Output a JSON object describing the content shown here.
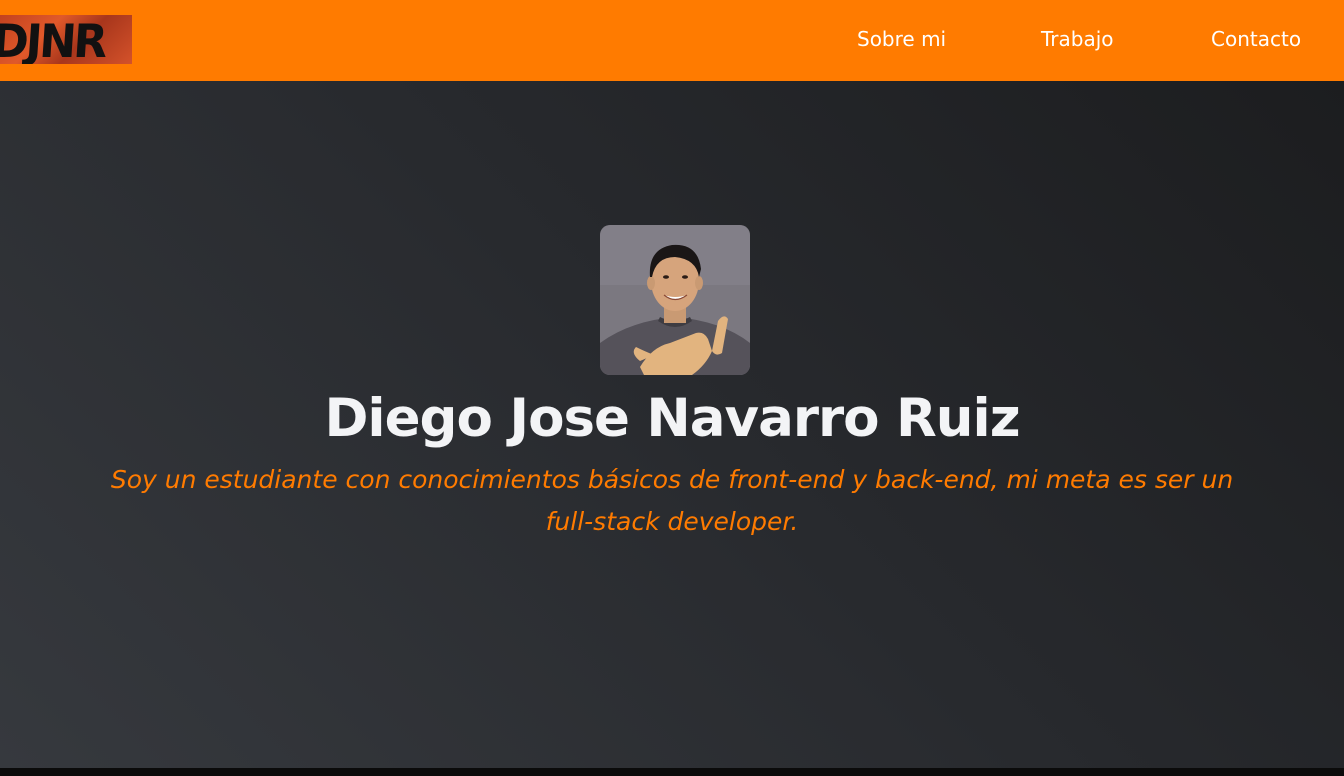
{
  "brand": {
    "logo_text": "DJNR",
    "colors": {
      "accent": "#ff7b00",
      "background_dark": "#27292d",
      "title_text": "#f3f4f6"
    }
  },
  "nav": {
    "items": [
      {
        "label": "Sobre mi"
      },
      {
        "label": "Trabajo"
      },
      {
        "label": "Contacto"
      }
    ]
  },
  "hero": {
    "name": "Diego Jose Navarro Ruiz",
    "bio_line_1": "Soy un estudiante con conocimientos básicos de front-end y back-end, mi meta es ser un",
    "bio_line_2": "full-stack developer."
  }
}
